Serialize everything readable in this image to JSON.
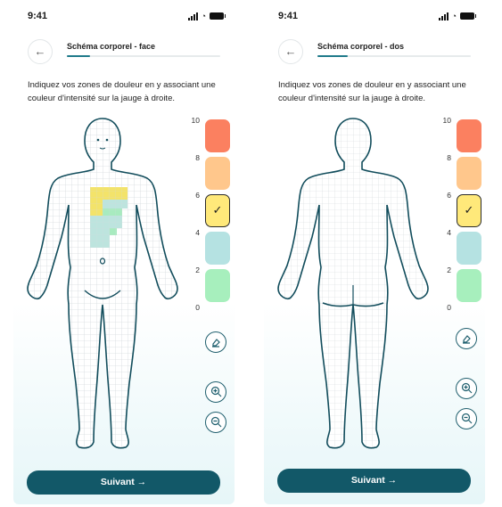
{
  "status_time": "9:41",
  "screens": [
    {
      "title": "Schéma corporel - face",
      "progress": 0.15,
      "instruction": "Indiquez vos zones de douleur en y associant une couleur d'intensité sur la jauge à droite.",
      "cta_label": "Suivant →"
    },
    {
      "title": "Schéma corporel - dos",
      "progress": 0.2,
      "instruction": "Indiquez vos zones de douleur en y associant une couleur d'intensité sur la jauge à droite.",
      "cta_label": "Suivant →"
    }
  ],
  "scale": {
    "ticks": [
      "10",
      "8",
      "6",
      "4",
      "2",
      "0"
    ],
    "swatches": [
      {
        "color": "#fb8060",
        "selected": false
      },
      {
        "color": "#ffc78c",
        "selected": false
      },
      {
        "color": "#ffe97a",
        "selected": true
      },
      {
        "color": "#b5e2e2",
        "selected": false
      },
      {
        "color": "#a7efbd",
        "selected": false
      }
    ],
    "check_mark": "✓"
  },
  "icons": {
    "back": "←",
    "eraser": "eraser-icon",
    "zoom_in": "zoom-in-icon",
    "zoom_out": "zoom-out-icon"
  },
  "marked_regions": {
    "yellow": "#f3e36a",
    "teal": "#bde4de",
    "green": "#a8ebbf",
    "outline": "#124d5c"
  }
}
